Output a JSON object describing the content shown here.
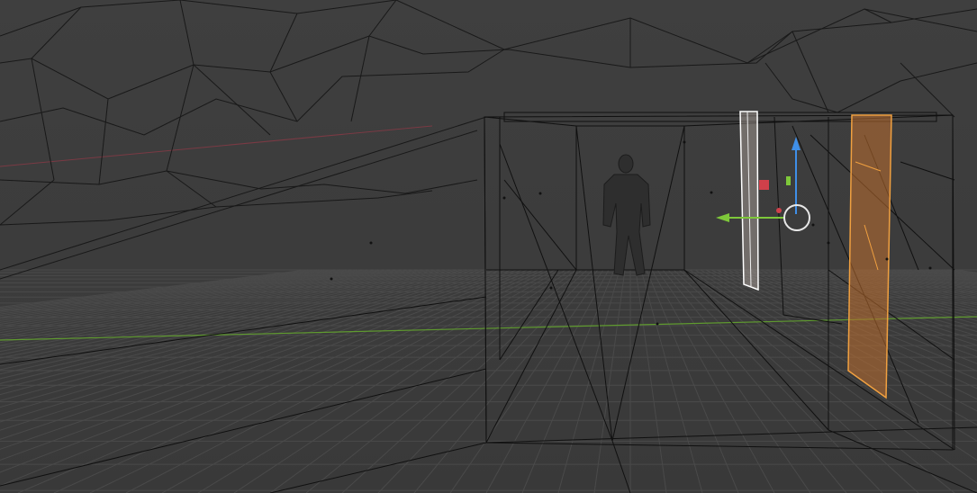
{
  "app": "3D viewport",
  "view": {
    "shading": "wireframe",
    "background": "#3d3d3d",
    "grid_color": "#4a4a4a",
    "wire_color": "#111111",
    "selected_color": "#f0a040",
    "active_color": "#ffffff"
  },
  "axes": {
    "x_axis_color": "#8a3a44",
    "y_axis_color": "#6aa03a",
    "z_axis_color": "#3f8fe8"
  },
  "gizmo": {
    "z_handle_icon": "arrow-up-icon",
    "y_handle_icon": "arrow-left-icon",
    "x_handle_icon": "square-red-icon",
    "center_icon": "ring-icon"
  },
  "objects": [
    {
      "name": "human-figure",
      "icon": "character-silhouette"
    },
    {
      "name": "door-panel-white",
      "state": "active"
    },
    {
      "name": "door-panel-orange",
      "state": "selected"
    }
  ]
}
